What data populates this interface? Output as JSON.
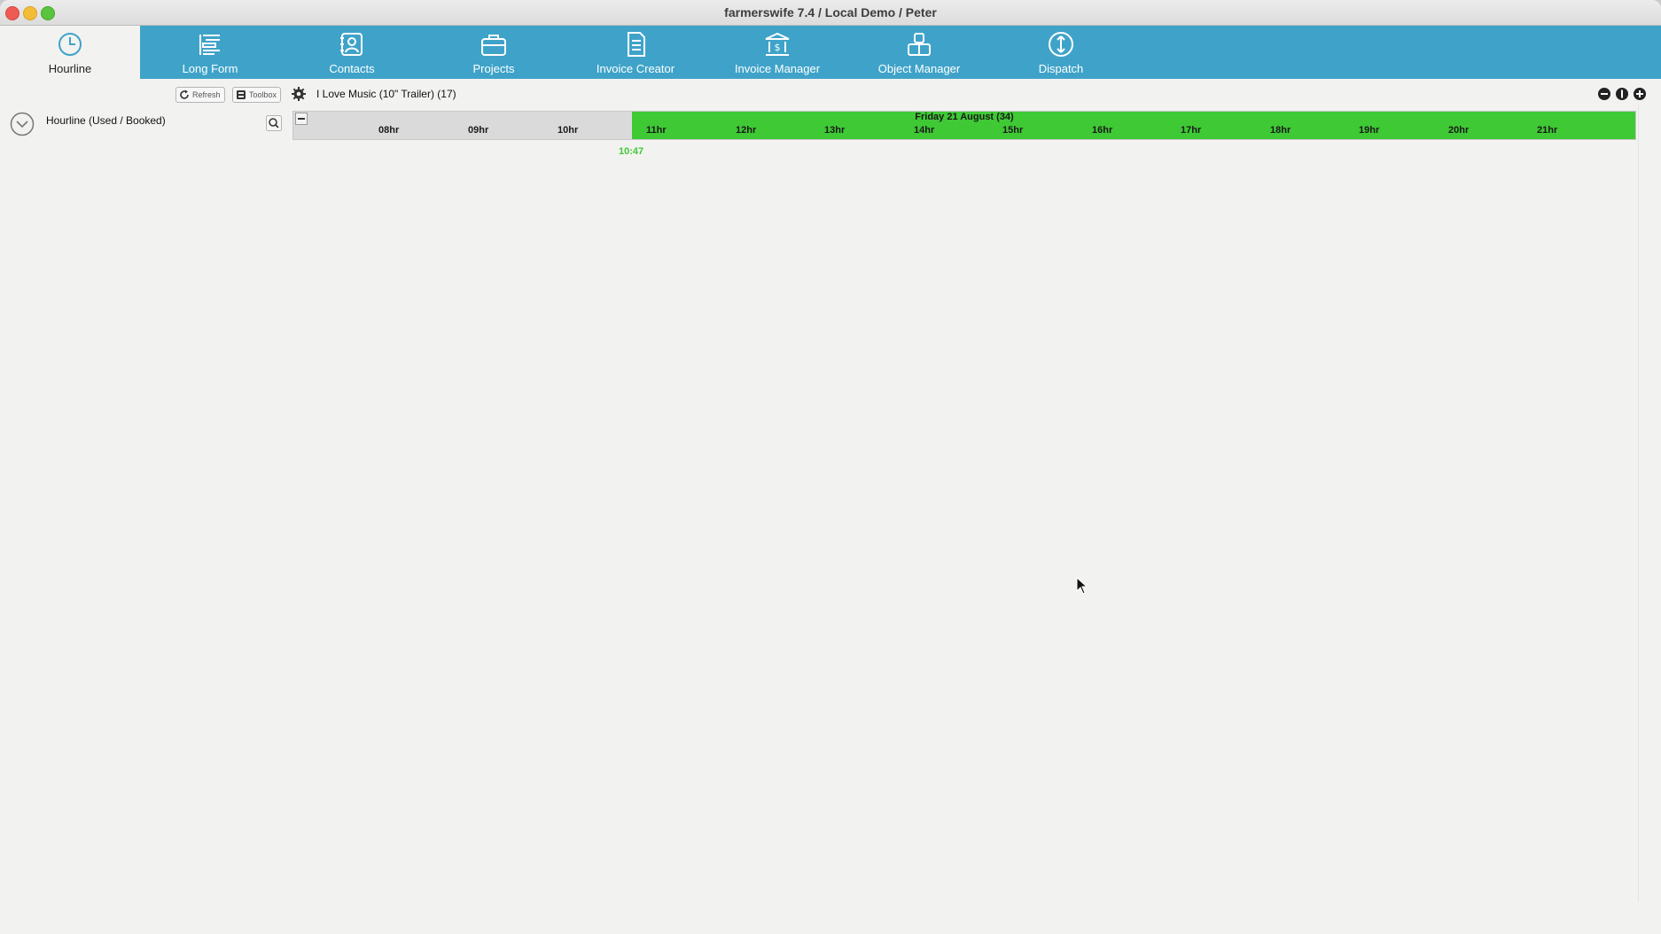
{
  "window": {
    "title": "farmerswife 7.4  / Local Demo / Peter"
  },
  "nav": {
    "items": [
      {
        "label": "Hourline",
        "icon": "clock-icon",
        "active": true
      },
      {
        "label": "Long Form",
        "icon": "long-form-icon"
      },
      {
        "label": "Contacts",
        "icon": "contacts-icon"
      },
      {
        "label": "Projects",
        "icon": "briefcase-icon"
      },
      {
        "label": "Invoice Creator",
        "icon": "document-icon"
      },
      {
        "label": "Invoice Manager",
        "icon": "bank-icon"
      },
      {
        "label": "Object Manager",
        "icon": "objects-icon"
      },
      {
        "label": "Dispatch",
        "icon": "dispatch-icon"
      }
    ],
    "color": "#3fa3c9"
  },
  "toolbar": {
    "refresh_label": "Refresh",
    "toolbox_label": "Toolbox",
    "project_label": "I Love Music (10\" Trailer) (17)"
  },
  "panel": {
    "title": "Hourline (Used / Booked)"
  },
  "timeline": {
    "date_label": "Friday 21 August (34)",
    "hours": [
      "08hr",
      "09hr",
      "10hr",
      "11hr",
      "12hr",
      "13hr",
      "14hr",
      "15hr",
      "16hr",
      "17hr",
      "18hr",
      "19hr",
      "20hr",
      "21hr"
    ],
    "now_time": "10:47",
    "available_color": "#3fc935"
  }
}
